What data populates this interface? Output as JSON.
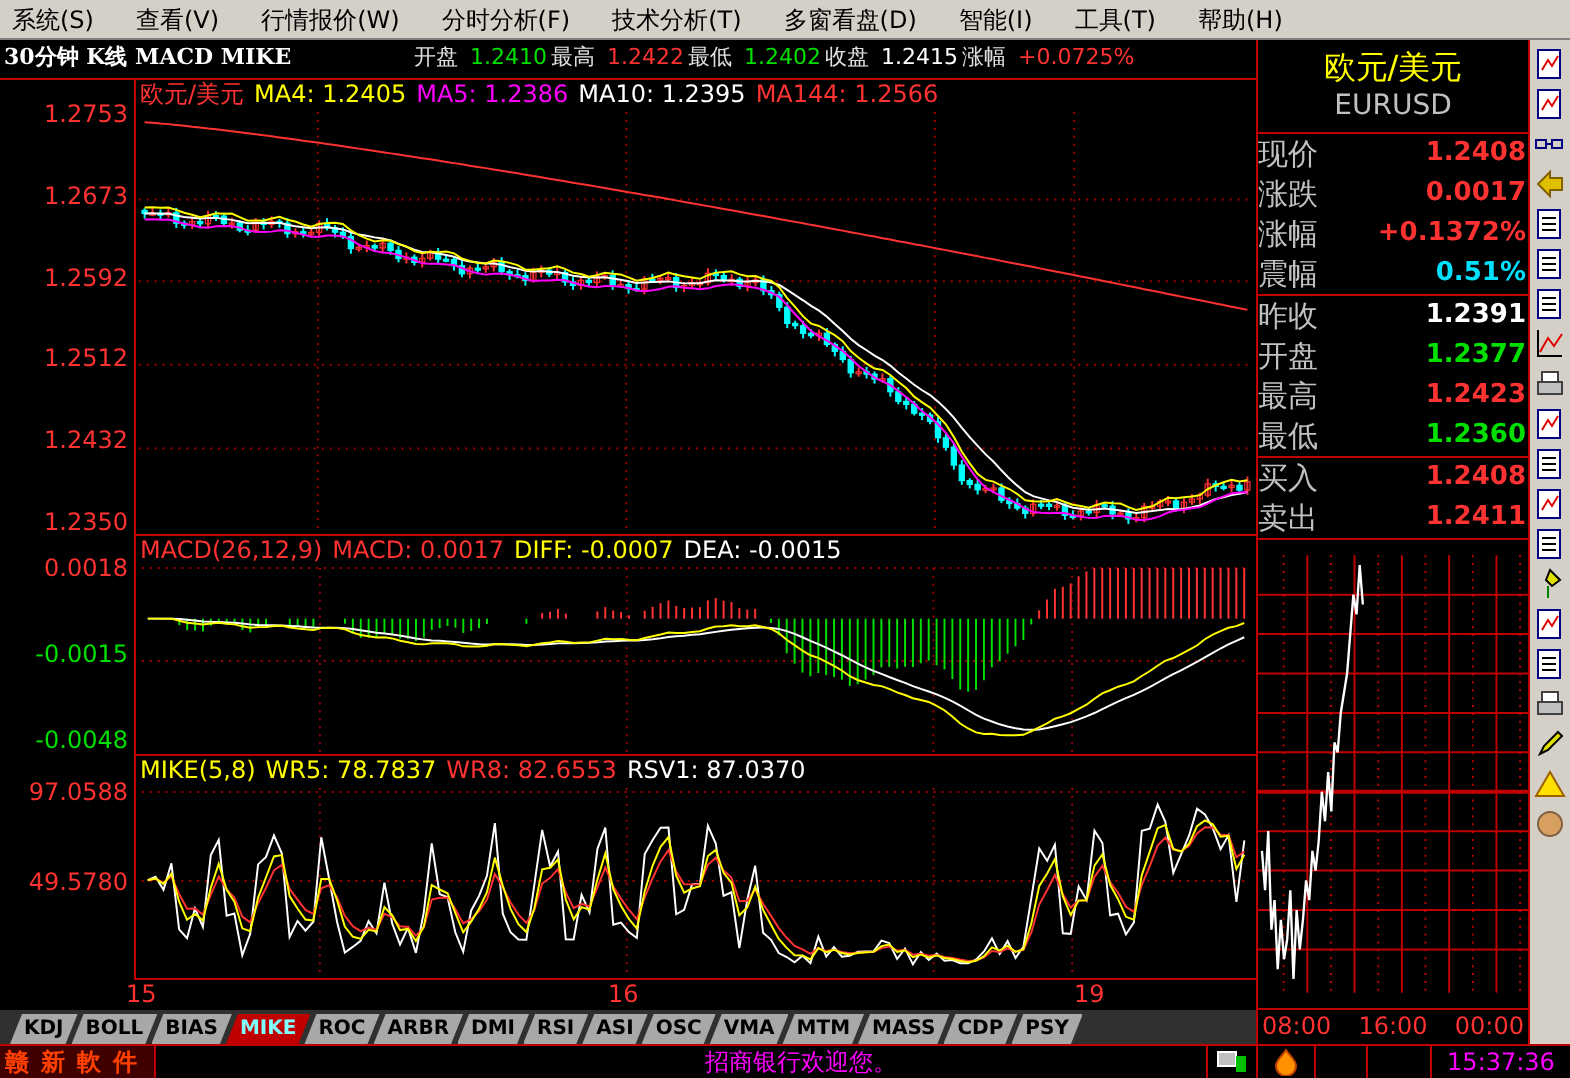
{
  "menu": [
    "系统(S)",
    "查看(V)",
    "行情报价(W)",
    "分时分析(F)",
    "技术分析(T)",
    "多窗看盘(D)",
    "智能(I)",
    "工具(T)",
    "帮助(H)"
  ],
  "header": {
    "title": "30分钟 K线 MACD MIKE",
    "quote": [
      {
        "label": "开盘",
        "value": "1.2410",
        "color": "#00e000"
      },
      {
        "label": "最高",
        "value": "1.2422",
        "color": "#ff3232"
      },
      {
        "label": "最低",
        "value": "1.2402",
        "color": "#00e000"
      },
      {
        "label": "收盘",
        "value": "1.2415",
        "color": "#ffffff"
      },
      {
        "label": "涨幅",
        "value": "+0.0725%",
        "color": "#ff3232"
      }
    ]
  },
  "panels": [
    {
      "kind": "candles",
      "legend": [
        {
          "text": "欧元/美元",
          "color": "#ff3232"
        },
        {
          "text": "MA4: 1.2405",
          "color": "#ffff00"
        },
        {
          "text": "MA5: 1.2386",
          "color": "#ff00ff"
        },
        {
          "text": "MA10: 1.2395",
          "color": "#ffffff"
        },
        {
          "text": "MA144: 1.2566",
          "color": "#ff3232"
        }
      ],
      "y_labels": [
        {
          "text": "1.2753",
          "color": "#ff3232"
        },
        {
          "text": "1.2673",
          "color": "#ff3232"
        },
        {
          "text": "1.2592",
          "color": "#ff3232"
        },
        {
          "text": "1.2512",
          "color": "#ff3232"
        },
        {
          "text": "1.2432",
          "color": "#ff3232"
        },
        {
          "text": "1.2350",
          "color": "#ff3232"
        }
      ]
    },
    {
      "kind": "macd",
      "legend": [
        {
          "text": "MACD(26,12,9)",
          "color": "#ff3232"
        },
        {
          "text": "MACD: 0.0017",
          "color": "#ff3232"
        },
        {
          "text": "DIFF: -0.0007",
          "color": "#ffff00"
        },
        {
          "text": "DEA: -0.0015",
          "color": "#ffffff"
        }
      ],
      "y_labels": [
        {
          "text": "0.0018",
          "color": "#ff3232"
        },
        {
          "text": "-0.0015",
          "color": "#00e000"
        },
        {
          "text": "-0.0048",
          "color": "#00e000"
        }
      ]
    },
    {
      "kind": "mike",
      "legend": [
        {
          "text": "MIKE(5,8)",
          "color": "#ffff00"
        },
        {
          "text": "WR5: 78.7837",
          "color": "#ffff00"
        },
        {
          "text": "WR8: 82.6553",
          "color": "#ff3232"
        },
        {
          "text": "RSV1: 87.0370",
          "color": "#ffffff"
        }
      ],
      "y_labels": [
        {
          "text": "97.0588",
          "color": "#ff3232"
        },
        {
          "text": "49.5780",
          "color": "#ff3232"
        }
      ]
    }
  ],
  "x_labels": [
    "15",
    "16",
    "19"
  ],
  "tabs": [
    {
      "label": "KDJ",
      "selected": false
    },
    {
      "label": "BOLL",
      "selected": false
    },
    {
      "label": "BIAS",
      "selected": false
    },
    {
      "label": "MIKE",
      "selected": true
    },
    {
      "label": "ROC",
      "selected": false
    },
    {
      "label": "ARBR",
      "selected": false
    },
    {
      "label": "DMI",
      "selected": false
    },
    {
      "label": "RSI",
      "selected": false
    },
    {
      "label": "ASI",
      "selected": false
    },
    {
      "label": "OSC",
      "selected": false
    },
    {
      "label": "VMA",
      "selected": false
    },
    {
      "label": "MTM",
      "selected": false
    },
    {
      "label": "MASS",
      "selected": false
    },
    {
      "label": "CDP",
      "selected": false
    },
    {
      "label": "PSY",
      "selected": false
    }
  ],
  "quote_panel": {
    "name": "欧元/美元",
    "code": "EURUSD",
    "groups": [
      [
        {
          "label": "现价",
          "value": "1.2408",
          "color": "#ff3232"
        },
        {
          "label": "涨跌",
          "value": "0.0017",
          "color": "#ff3232"
        },
        {
          "label": "涨幅",
          "value": "+0.1372%",
          "color": "#ff3232"
        },
        {
          "label": "震幅",
          "value": "0.51%",
          "color": "#00e0ff"
        }
      ],
      [
        {
          "label": "昨收",
          "value": "1.2391",
          "color": "#ffffff"
        },
        {
          "label": "开盘",
          "value": "1.2377",
          "color": "#00e000"
        },
        {
          "label": "最高",
          "value": "1.2423",
          "color": "#ff3232"
        },
        {
          "label": "最低",
          "value": "1.2360",
          "color": "#00e000"
        }
      ],
      [
        {
          "label": "买入",
          "value": "1.2408",
          "color": "#ff3232"
        },
        {
          "label": "卖出",
          "value": "1.2411",
          "color": "#ff3232"
        }
      ]
    ],
    "time_labels": [
      "08:00",
      "16:00",
      "00:00"
    ]
  },
  "status_bar": {
    "brand": "赣新軟件",
    "message": "招商银行欢迎您。",
    "time": "15:37:36"
  }
}
